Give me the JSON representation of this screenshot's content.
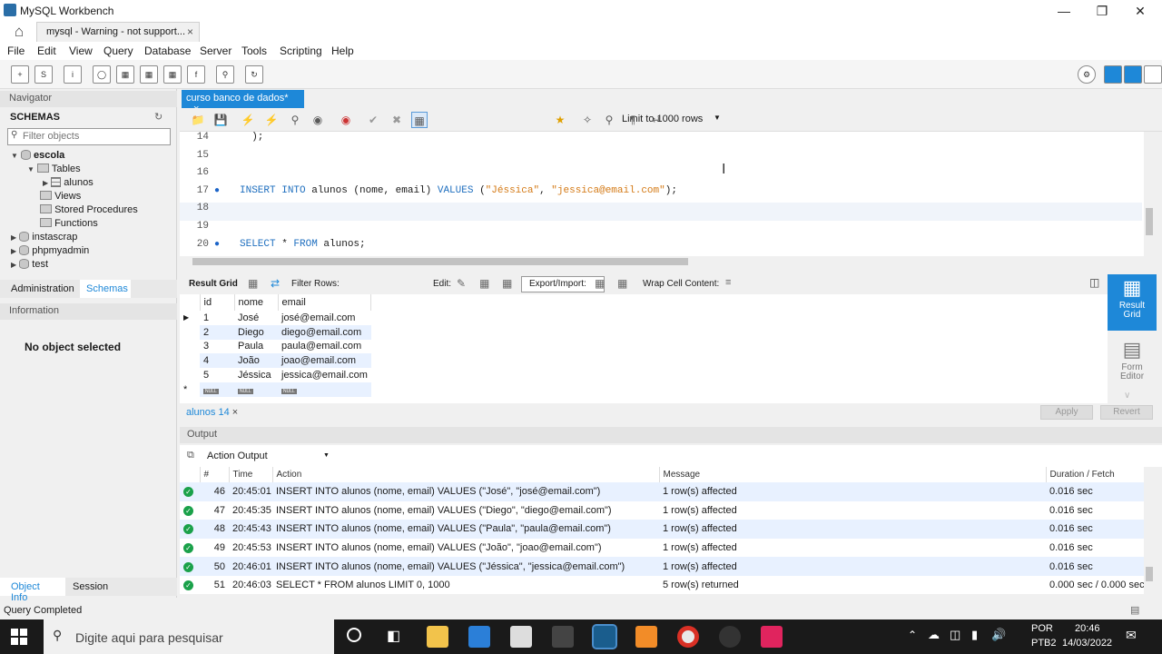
{
  "window": {
    "title": "MySQL Workbench"
  },
  "connection_tab": {
    "label": "mysql - Warning - not support..."
  },
  "menu": [
    "File",
    "Edit",
    "View",
    "Query",
    "Database",
    "Server",
    "Tools",
    "Scripting",
    "Help"
  ],
  "sidebar": {
    "navigator": "Navigator",
    "schemas_title": "SCHEMAS",
    "filter_placeholder": "Filter objects",
    "tree": {
      "db_escola": "escola",
      "tables": "Tables",
      "alunos": "alunos",
      "views": "Views",
      "stored_procedures": "Stored Procedures",
      "functions": "Functions",
      "db_instascrap": "instascrap",
      "db_phpmyadmin": "phpmyadmin",
      "db_test": "test"
    },
    "tab_administration": "Administration",
    "tab_schemas": "Schemas",
    "information": "Information",
    "no_object": "No object selected",
    "tab_object_info": "Object Info",
    "tab_session": "Session"
  },
  "editor": {
    "tab_label": "curso banco de dados*",
    "limit": "Limit to 1000 rows",
    "lines": [
      {
        "n": "14",
        "code": "  );"
      },
      {
        "n": "15",
        "code": ""
      },
      {
        "n": "16",
        "code": ""
      },
      {
        "n": "17",
        "code": "INSERT INTO alunos (nome, email) VALUES (\"Jéssica\", \"jessica@email.com\");"
      },
      {
        "n": "18",
        "code": ""
      },
      {
        "n": "19",
        "code": ""
      },
      {
        "n": "20",
        "code": "SELECT * FROM alunos;"
      }
    ]
  },
  "results": {
    "result_grid": "Result Grid",
    "filter_rows": "Filter Rows:",
    "edit": "Edit:",
    "export_import": "Export/Import:",
    "wrap_cell": "Wrap Cell Content:",
    "columns": [
      "id",
      "nome",
      "email"
    ],
    "rows": [
      [
        "1",
        "José",
        "josé@email.com"
      ],
      [
        "2",
        "Diego",
        "diego@email.com"
      ],
      [
        "3",
        "Paula",
        "paula@email.com"
      ],
      [
        "4",
        "João",
        "joao@email.com"
      ],
      [
        "5",
        "Jéssica",
        "jessica@email.com"
      ]
    ],
    "null_label": "NULL",
    "panel_result": "Result Grid",
    "panel_form": "Form Editor",
    "result_tab": "alunos 14",
    "apply": "Apply",
    "revert": "Revert"
  },
  "output": {
    "title": "Output",
    "selector": "Action Output",
    "columns": [
      "#",
      "Time",
      "Action",
      "Message",
      "Duration / Fetch"
    ],
    "rows": [
      {
        "n": "46",
        "time": "20:45:01",
        "action": "INSERT INTO alunos (nome, email) VALUES (\"José\", \"josé@email.com\")",
        "message": "1 row(s) affected",
        "duration": "0.016 sec"
      },
      {
        "n": "47",
        "time": "20:45:35",
        "action": "INSERT INTO alunos (nome, email) VALUES (\"Diego\", \"diego@email.com\")",
        "message": "1 row(s) affected",
        "duration": "0.016 sec"
      },
      {
        "n": "48",
        "time": "20:45:43",
        "action": "INSERT INTO alunos (nome, email) VALUES (\"Paula\", \"paula@email.com\")",
        "message": "1 row(s) affected",
        "duration": "0.016 sec"
      },
      {
        "n": "49",
        "time": "20:45:53",
        "action": "INSERT INTO alunos (nome, email) VALUES (\"João\", \"joao@email.com\")",
        "message": "1 row(s) affected",
        "duration": "0.016 sec"
      },
      {
        "n": "50",
        "time": "20:46:01",
        "action": "INSERT INTO alunos (nome, email) VALUES (\"Jéssica\", \"jessica@email.com\")",
        "message": "1 row(s) affected",
        "duration": "0.016 sec"
      },
      {
        "n": "51",
        "time": "20:46:03",
        "action": "SELECT * FROM alunos LIMIT 0, 1000",
        "message": "5 row(s) returned",
        "duration": "0.000 sec / 0.000 sec"
      }
    ]
  },
  "status": "Query Completed",
  "taskbar": {
    "search_placeholder": "Digite aqui para pesquisar",
    "lang": "POR",
    "layout": "PTB2",
    "time": "20:46",
    "date": "14/03/2022"
  },
  "colors": {
    "accent": "#1e88d8",
    "success": "#1aa14a",
    "keyword": "#1f6fbf",
    "string": "#d47a16"
  }
}
